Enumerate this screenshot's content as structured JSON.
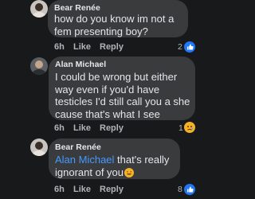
{
  "comments": [
    {
      "author": "Bear Renée",
      "text": "how do you know im not a fem presenting boy?",
      "time": "6h",
      "like": "Like",
      "reply": "Reply",
      "reaction_count": "2",
      "reaction": "like-reaction-icon"
    },
    {
      "author": "Alan Michael",
      "text": "I could be wrong but either way even if you'd have testicles I'd still call you a she cause that's what I see",
      "time": "6h",
      "like": "Like",
      "reply": "Reply",
      "reaction_count": "1",
      "reaction": "sad-reaction-icon"
    },
    {
      "author": "Bear Renée",
      "mention": "Alan Michael",
      "text": " that's really ignorant of you",
      "time": "6h",
      "like": "Like",
      "reply": "Reply",
      "reaction_count": "8",
      "reaction": "like-reaction-icon"
    }
  ],
  "colors": {
    "background": "#18191a",
    "bubble": "#3a3b3c",
    "text": "#e4e6eb",
    "meta": "#b0b3b8",
    "mention": "#4599ff",
    "like_reaction": "#2078f4",
    "sad_reaction": "#f7b125"
  }
}
